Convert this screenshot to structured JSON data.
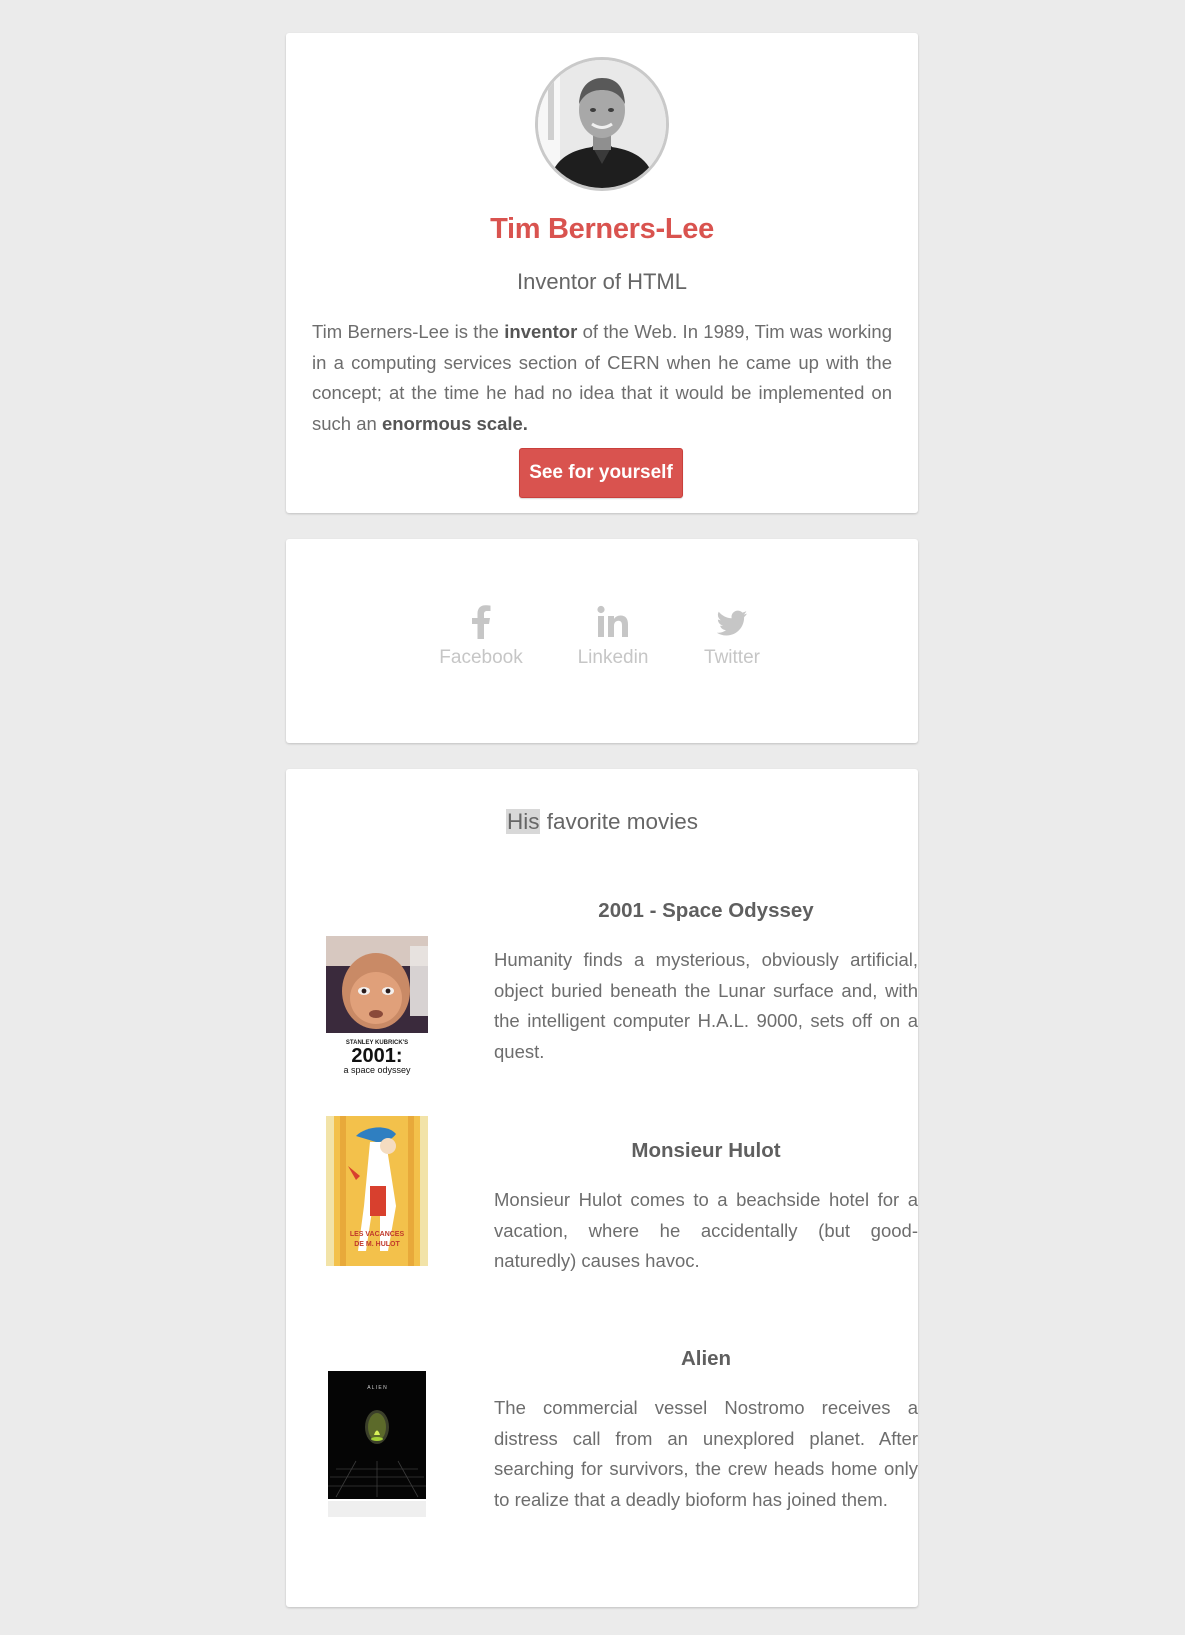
{
  "profile": {
    "name": "Tim Berners-Lee",
    "role": "Inventor of HTML",
    "bio": {
      "part1": "Tim Berners-Lee is the ",
      "bold1": "inventor",
      "part2": " of the Web. In 1989, Tim was working in a computing services section of CERN when he came up with the concept; at the time he had no idea that it would be implemented on such an ",
      "bold2": "enormous scale."
    },
    "cta_label": "See for yourself"
  },
  "social": {
    "links": [
      {
        "label": "Facebook",
        "icon": "facebook-icon"
      },
      {
        "label": "Linkedin",
        "icon": "linkedin-icon"
      },
      {
        "label": "Twitter",
        "icon": "twitter-icon"
      }
    ]
  },
  "movies": {
    "title_highlight": "His",
    "title_rest": " favorite movies",
    "items": [
      {
        "title": "2001 - Space Odyssey",
        "description": "Humanity finds a mysterious, obviously artificial, object buried beneath the Lunar surface and, with the intelligent computer H.A.L. 9000, sets off on a quest.",
        "poster_text": {
          "line1": "STANLEY KUBRICK'S",
          "line2": "2001:",
          "line3": "a space odyssey"
        }
      },
      {
        "title": "Monsieur Hulot",
        "description": "Monsieur Hulot comes to a beachside hotel for a vacation, where he accidentally (but good-naturedly) causes havoc.",
        "poster_text": {
          "line1": "LES VACANCES",
          "line2": "DE M. HULOT"
        }
      },
      {
        "title": "Alien",
        "description": "The commercial vessel Nostromo receives a distress call from an unexplored planet. After searching for survivors, the crew heads home only to realize that a deadly bioform has joined them.",
        "poster_text": {
          "line1": "A L I E N"
        }
      }
    ]
  },
  "colors": {
    "accent": "#d9534f",
    "background": "#ebebeb",
    "card": "#ffffff",
    "social_icon": "#c6c6c6",
    "text": "#666666"
  }
}
